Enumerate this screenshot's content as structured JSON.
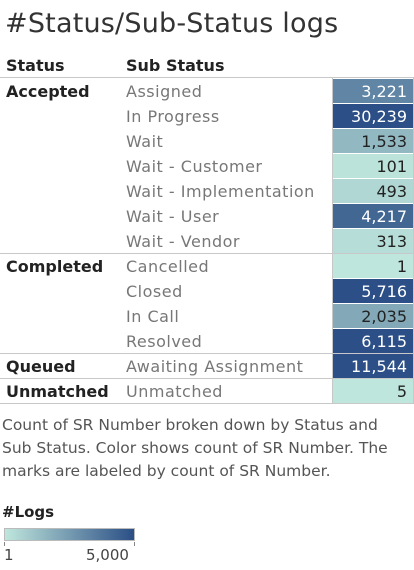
{
  "title": "#Status/Sub-Status logs",
  "chart_data": {
    "type": "table",
    "columns": [
      "Status",
      "Sub Status"
    ],
    "measure": "count of SR Number",
    "groups": [
      {
        "status": "Accepted",
        "rows": [
          {
            "sub_status": "Assigned",
            "value": 3221,
            "label": "3,221"
          },
          {
            "sub_status": "In Progress",
            "value": 30239,
            "label": "30,239"
          },
          {
            "sub_status": "Wait",
            "value": 1533,
            "label": "1,533"
          },
          {
            "sub_status": "Wait - Customer",
            "value": 101,
            "label": "101"
          },
          {
            "sub_status": "Wait - Implementation",
            "value": 493,
            "label": "493"
          },
          {
            "sub_status": "Wait - User",
            "value": 4217,
            "label": "4,217"
          },
          {
            "sub_status": "Wait - Vendor",
            "value": 313,
            "label": "313"
          }
        ]
      },
      {
        "status": "Completed",
        "rows": [
          {
            "sub_status": "Cancelled",
            "value": 1,
            "label": "1"
          },
          {
            "sub_status": "Closed",
            "value": 5716,
            "label": "5,716"
          },
          {
            "sub_status": "In Call",
            "value": 2035,
            "label": "2,035"
          },
          {
            "sub_status": "Resolved",
            "value": 6115,
            "label": "6,115"
          }
        ]
      },
      {
        "status": "Queued",
        "rows": [
          {
            "sub_status": "Awaiting Assignment",
            "value": 11544,
            "label": "11,544"
          }
        ]
      },
      {
        "status": "Unmatched",
        "rows": [
          {
            "sub_status": "Unmatched",
            "value": 5,
            "label": "5"
          }
        ]
      }
    ],
    "color_scale": {
      "min": 1,
      "max": 5000,
      "min_color": "#bfe6dc",
      "max_color": "#2b4f86"
    }
  },
  "caption": "Count of SR Number broken down by Status and Sub Status.  Color shows count of SR Number.  The marks are labeled by count of SR Number.",
  "legend": {
    "title": "#Logs",
    "min_label": "1",
    "max_label": "5,000"
  }
}
